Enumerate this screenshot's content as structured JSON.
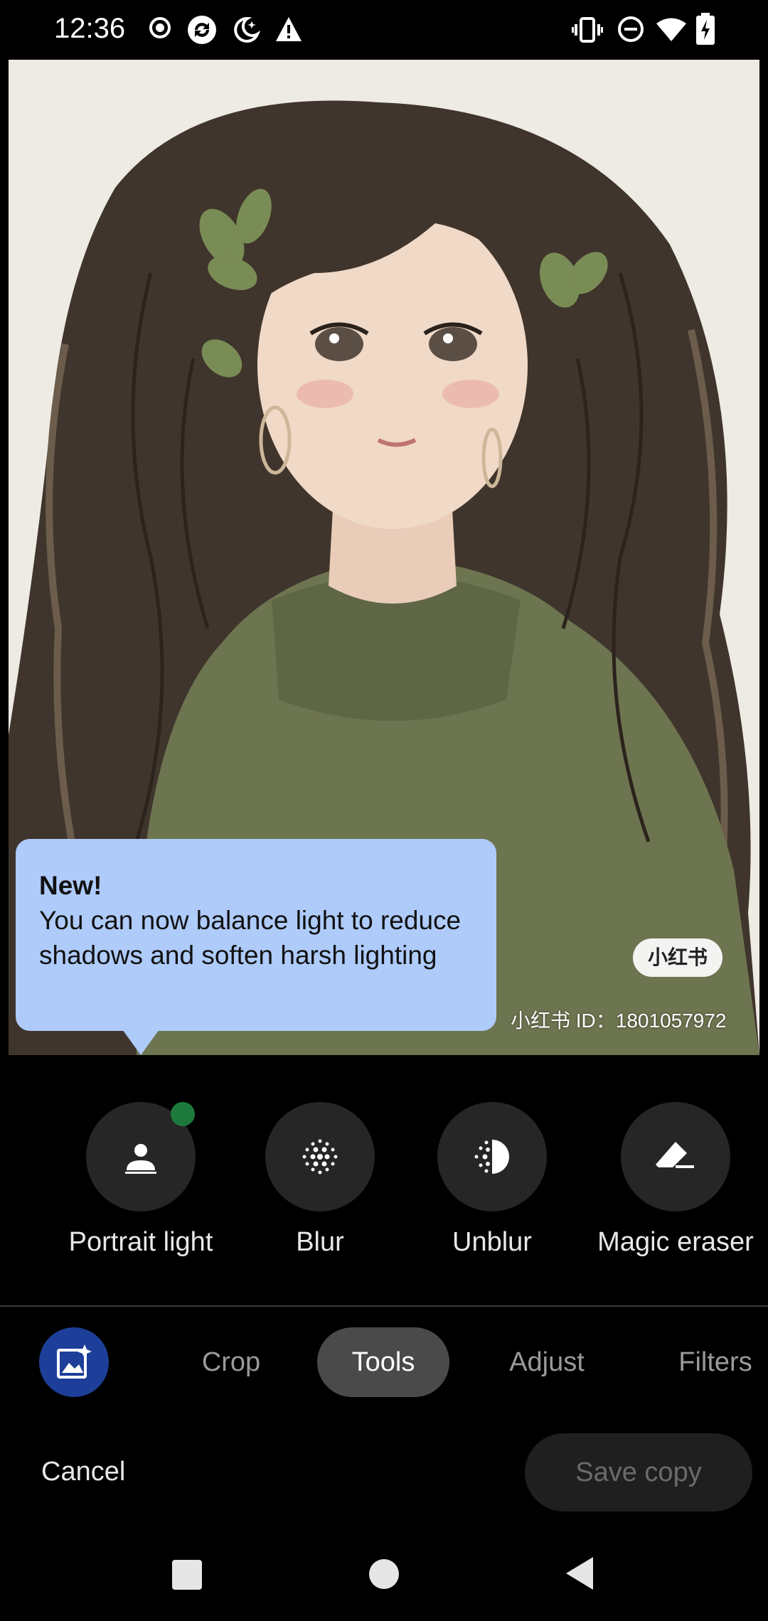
{
  "status_bar": {
    "time": "12:36",
    "left_icons": [
      "record-icon",
      "sync-icon",
      "night-mode-icon",
      "warning-icon"
    ],
    "right_icons": [
      "vibrate-icon",
      "do-not-disturb-icon",
      "wifi-icon",
      "battery-icon"
    ]
  },
  "photo": {
    "watermark_badge": "小红书",
    "watermark_id": "小红书 ID：1801057972"
  },
  "tooltip": {
    "title": "New!",
    "body": "You can now balance light to reduce shadows and soften harsh lighting"
  },
  "tools": [
    {
      "label": "Portrait light",
      "icon": "portrait-light-icon",
      "new": true
    },
    {
      "label": "Blur",
      "icon": "blur-icon"
    },
    {
      "label": "Unblur",
      "icon": "unblur-icon"
    },
    {
      "label": "Magic eraser",
      "icon": "eraser-icon"
    }
  ],
  "tabs": {
    "suggestions_icon": "auto-enhance-icon",
    "items": [
      "Crop",
      "Tools",
      "Adjust",
      "Filters"
    ],
    "active": "Tools"
  },
  "actions": {
    "cancel": "Cancel",
    "save": "Save copy"
  },
  "nav": [
    "recents-icon",
    "home-icon",
    "back-icon"
  ],
  "colors": {
    "tooltip": "#aecbfa",
    "accent_button": "#1d3f9a",
    "new_dot": "#1e7a3c"
  }
}
